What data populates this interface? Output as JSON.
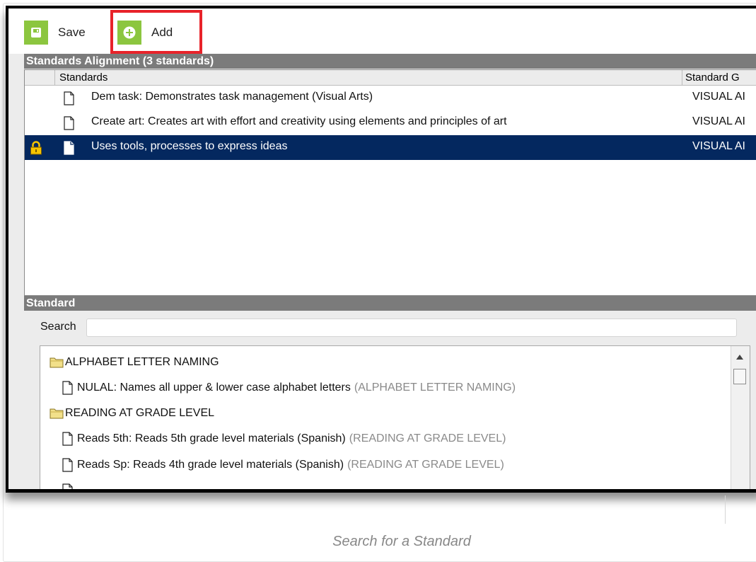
{
  "toolbar": {
    "save_label": "Save",
    "add_label": "Add"
  },
  "alignment": {
    "title": "Standards Alignment (3 standards)",
    "columns": {
      "standards": "Standards",
      "group": "Standard G"
    },
    "rows": [
      {
        "text": "Dem task: Demonstrates task management (Visual Arts)",
        "group": "VISUAL AI"
      },
      {
        "text": "Create art: Creates art with effort and creativity using elements and principles of art",
        "group": "VISUAL AI"
      },
      {
        "text": "Uses tools, processes to express ideas",
        "group": "VISUAL AI",
        "selected": true,
        "locked": true
      }
    ]
  },
  "standard": {
    "title": "Standard",
    "search_label": "Search",
    "search_value": "",
    "tree": [
      {
        "type": "folder",
        "label": "ALPHABET LETTER NAMING"
      },
      {
        "type": "doc",
        "label": "NULAL: Names all upper & lower case alphabet letters",
        "category": "(ALPHABET LETTER NAMING)"
      },
      {
        "type": "folder",
        "label": "READING AT GRADE LEVEL"
      },
      {
        "type": "doc",
        "label": "Reads 5th: Reads 5th grade level materials (Spanish)",
        "category": "(READING AT GRADE LEVEL)"
      },
      {
        "type": "doc",
        "label": "Reads Sp: Reads 4th grade level materials (Spanish)",
        "category": "(READING AT GRADE LEVEL)"
      }
    ]
  },
  "caption": "Search for a Standard",
  "colors": {
    "accent_green": "#8cc63f",
    "highlight_red": "#e8232a",
    "selected_row": "#04285f",
    "section_header": "#7b7b7b"
  },
  "icons": {
    "save": "save-icon",
    "add": "plus-circle-icon",
    "doc": "document-icon",
    "lock": "lock-icon",
    "folder": "folder-icon"
  }
}
